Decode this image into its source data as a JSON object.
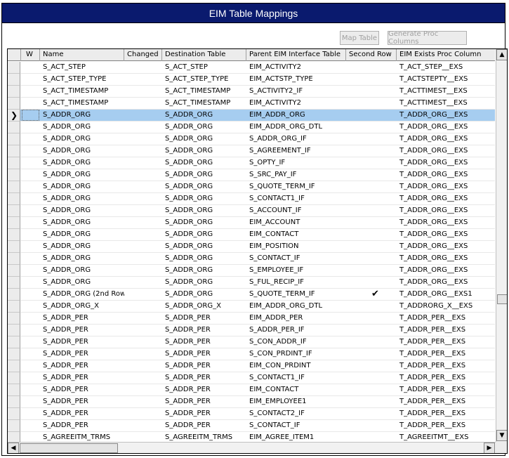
{
  "window": {
    "title": "EIM Table Mappings"
  },
  "toolbar": {
    "map_table": "Map Table",
    "generate_proc_columns": "Generate Proc Columns"
  },
  "columns": {
    "w": "W",
    "name": "Name",
    "changed": "Changed",
    "destination": "Destination Table",
    "parent": "Parent EIM Interface Table",
    "second_row": "Second Row",
    "exists_proc": "EIM Exists Proc Column"
  },
  "selected_row_index": 4,
  "rows": [
    {
      "name": "S_ACT_STEP",
      "destination": "S_ACT_STEP",
      "parent": "EIM_ACTIVITY2",
      "second_row": false,
      "exists_proc": "T_ACT_STEP__EXS"
    },
    {
      "name": "S_ACT_STEP_TYPE",
      "destination": "S_ACT_STEP_TYPE",
      "parent": "EIM_ACTSTP_TYPE",
      "second_row": false,
      "exists_proc": "T_ACTSTEPTY__EXS"
    },
    {
      "name": "S_ACT_TIMESTAMP",
      "destination": "S_ACT_TIMESTAMP",
      "parent": "S_ACTIVITY2_IF",
      "second_row": false,
      "exists_proc": "T_ACTTIMEST__EXS"
    },
    {
      "name": "S_ACT_TIMESTAMP",
      "destination": "S_ACT_TIMESTAMP",
      "parent": "EIM_ACTIVITY2",
      "second_row": false,
      "exists_proc": "T_ACTTIMEST__EXS"
    },
    {
      "name": "S_ADDR_ORG",
      "destination": "S_ADDR_ORG",
      "parent": "EIM_ADDR_ORG",
      "second_row": false,
      "exists_proc": "T_ADDR_ORG__EXS"
    },
    {
      "name": "S_ADDR_ORG",
      "destination": "S_ADDR_ORG",
      "parent": "EIM_ADDR_ORG_DTL",
      "second_row": false,
      "exists_proc": "T_ADDR_ORG__EXS"
    },
    {
      "name": "S_ADDR_ORG",
      "destination": "S_ADDR_ORG",
      "parent": "S_ADDR_ORG_IF",
      "second_row": false,
      "exists_proc": "T_ADDR_ORG__EXS"
    },
    {
      "name": "S_ADDR_ORG",
      "destination": "S_ADDR_ORG",
      "parent": "S_AGREEMENT_IF",
      "second_row": false,
      "exists_proc": "T_ADDR_ORG__EXS"
    },
    {
      "name": "S_ADDR_ORG",
      "destination": "S_ADDR_ORG",
      "parent": "S_OPTY_IF",
      "second_row": false,
      "exists_proc": "T_ADDR_ORG__EXS"
    },
    {
      "name": "S_ADDR_ORG",
      "destination": "S_ADDR_ORG",
      "parent": "S_SRC_PAY_IF",
      "second_row": false,
      "exists_proc": "T_ADDR_ORG__EXS"
    },
    {
      "name": "S_ADDR_ORG",
      "destination": "S_ADDR_ORG",
      "parent": "S_QUOTE_TERM_IF",
      "second_row": false,
      "exists_proc": "T_ADDR_ORG__EXS"
    },
    {
      "name": "S_ADDR_ORG",
      "destination": "S_ADDR_ORG",
      "parent": "S_CONTACT1_IF",
      "second_row": false,
      "exists_proc": "T_ADDR_ORG__EXS"
    },
    {
      "name": "S_ADDR_ORG",
      "destination": "S_ADDR_ORG",
      "parent": "S_ACCOUNT_IF",
      "second_row": false,
      "exists_proc": "T_ADDR_ORG__EXS"
    },
    {
      "name": "S_ADDR_ORG",
      "destination": "S_ADDR_ORG",
      "parent": "EIM_ACCOUNT",
      "second_row": false,
      "exists_proc": "T_ADDR_ORG__EXS"
    },
    {
      "name": "S_ADDR_ORG",
      "destination": "S_ADDR_ORG",
      "parent": "EIM_CONTACT",
      "second_row": false,
      "exists_proc": "T_ADDR_ORG__EXS"
    },
    {
      "name": "S_ADDR_ORG",
      "destination": "S_ADDR_ORG",
      "parent": "EIM_POSITION",
      "second_row": false,
      "exists_proc": "T_ADDR_ORG__EXS"
    },
    {
      "name": "S_ADDR_ORG",
      "destination": "S_ADDR_ORG",
      "parent": "S_CONTACT_IF",
      "second_row": false,
      "exists_proc": "T_ADDR_ORG__EXS"
    },
    {
      "name": "S_ADDR_ORG",
      "destination": "S_ADDR_ORG",
      "parent": "S_EMPLOYEE_IF",
      "second_row": false,
      "exists_proc": "T_ADDR_ORG__EXS"
    },
    {
      "name": "S_ADDR_ORG",
      "destination": "S_ADDR_ORG",
      "parent": "S_FUL_RECIP_IF",
      "second_row": false,
      "exists_proc": "T_ADDR_ORG__EXS"
    },
    {
      "name": "S_ADDR_ORG (2nd Row",
      "destination": "S_ADDR_ORG",
      "parent": "S_QUOTE_TERM_IF",
      "second_row": true,
      "exists_proc": "T_ADDR_ORG__EXS1"
    },
    {
      "name": "S_ADDR_ORG_X",
      "destination": "S_ADDR_ORG_X",
      "parent": "EIM_ADDR_ORG_DTL",
      "second_row": false,
      "exists_proc": "T_ADDRORG_X__EXS"
    },
    {
      "name": "S_ADDR_PER",
      "destination": "S_ADDR_PER",
      "parent": "EIM_ADDR_PER",
      "second_row": false,
      "exists_proc": "T_ADDR_PER__EXS"
    },
    {
      "name": "S_ADDR_PER",
      "destination": "S_ADDR_PER",
      "parent": "S_ADDR_PER_IF",
      "second_row": false,
      "exists_proc": "T_ADDR_PER__EXS"
    },
    {
      "name": "S_ADDR_PER",
      "destination": "S_ADDR_PER",
      "parent": "S_CON_ADDR_IF",
      "second_row": false,
      "exists_proc": "T_ADDR_PER__EXS"
    },
    {
      "name": "S_ADDR_PER",
      "destination": "S_ADDR_PER",
      "parent": "S_CON_PRDINT_IF",
      "second_row": false,
      "exists_proc": "T_ADDR_PER__EXS"
    },
    {
      "name": "S_ADDR_PER",
      "destination": "S_ADDR_PER",
      "parent": "EIM_CON_PRDINT",
      "second_row": false,
      "exists_proc": "T_ADDR_PER__EXS"
    },
    {
      "name": "S_ADDR_PER",
      "destination": "S_ADDR_PER",
      "parent": "S_CONTACT1_IF",
      "second_row": false,
      "exists_proc": "T_ADDR_PER__EXS"
    },
    {
      "name": "S_ADDR_PER",
      "destination": "S_ADDR_PER",
      "parent": "EIM_CONTACT",
      "second_row": false,
      "exists_proc": "T_ADDR_PER__EXS"
    },
    {
      "name": "S_ADDR_PER",
      "destination": "S_ADDR_PER",
      "parent": "EIM_EMPLOYEE1",
      "second_row": false,
      "exists_proc": "T_ADDR_PER__EXS"
    },
    {
      "name": "S_ADDR_PER",
      "destination": "S_ADDR_PER",
      "parent": "S_CONTACT2_IF",
      "second_row": false,
      "exists_proc": "T_ADDR_PER__EXS"
    },
    {
      "name": "S_ADDR_PER",
      "destination": "S_ADDR_PER",
      "parent": "S_CONTACT_IF",
      "second_row": false,
      "exists_proc": "T_ADDR_PER__EXS"
    },
    {
      "name": "S_AGREEITM_TRMS",
      "destination": "S_AGREEITM_TRMS",
      "parent": "EIM_AGREE_ITEM1",
      "second_row": false,
      "exists_proc": "T_AGREEITMT__EXS"
    }
  ]
}
